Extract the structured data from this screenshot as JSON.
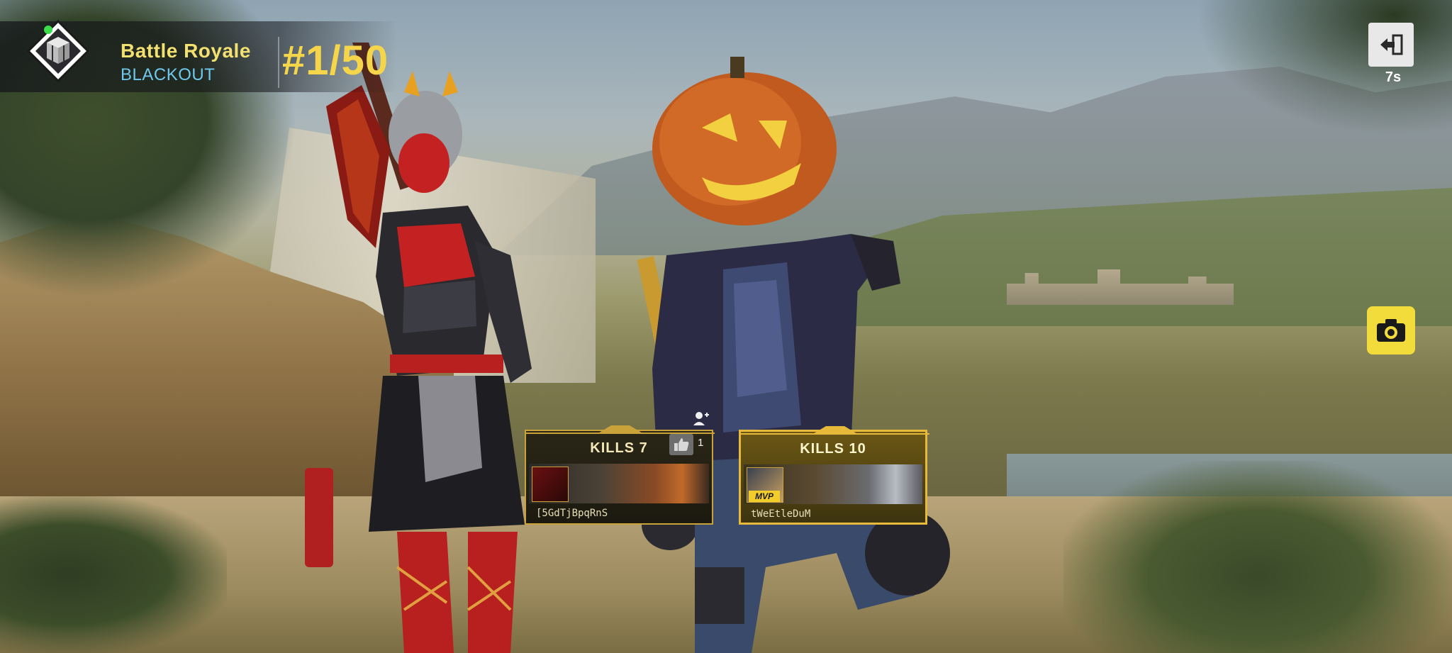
{
  "hud": {
    "mode_title": "Battle Royale",
    "mode_subtitle": "BLACKOUT",
    "placement": "#1/50",
    "mode_icon": "supply-crate-icon",
    "status": "online",
    "status_color": "#3ddc4c"
  },
  "exit": {
    "icon": "exit-icon",
    "timer": "7s"
  },
  "camera": {
    "icon": "camera-icon"
  },
  "players": [
    {
      "kills_label": "KILLS 7",
      "name": "[5GdTjBpqRnS",
      "mvp": false,
      "likes": "1"
    },
    {
      "kills_label": "KILLS 10",
      "name": "tWeEtleDuM",
      "mvp": true,
      "mvp_label": "MVP"
    }
  ],
  "colors": {
    "accent_yellow": "#f5d54a",
    "subtitle_blue": "#6fc8ee",
    "card_gold": "#c9a23a"
  }
}
